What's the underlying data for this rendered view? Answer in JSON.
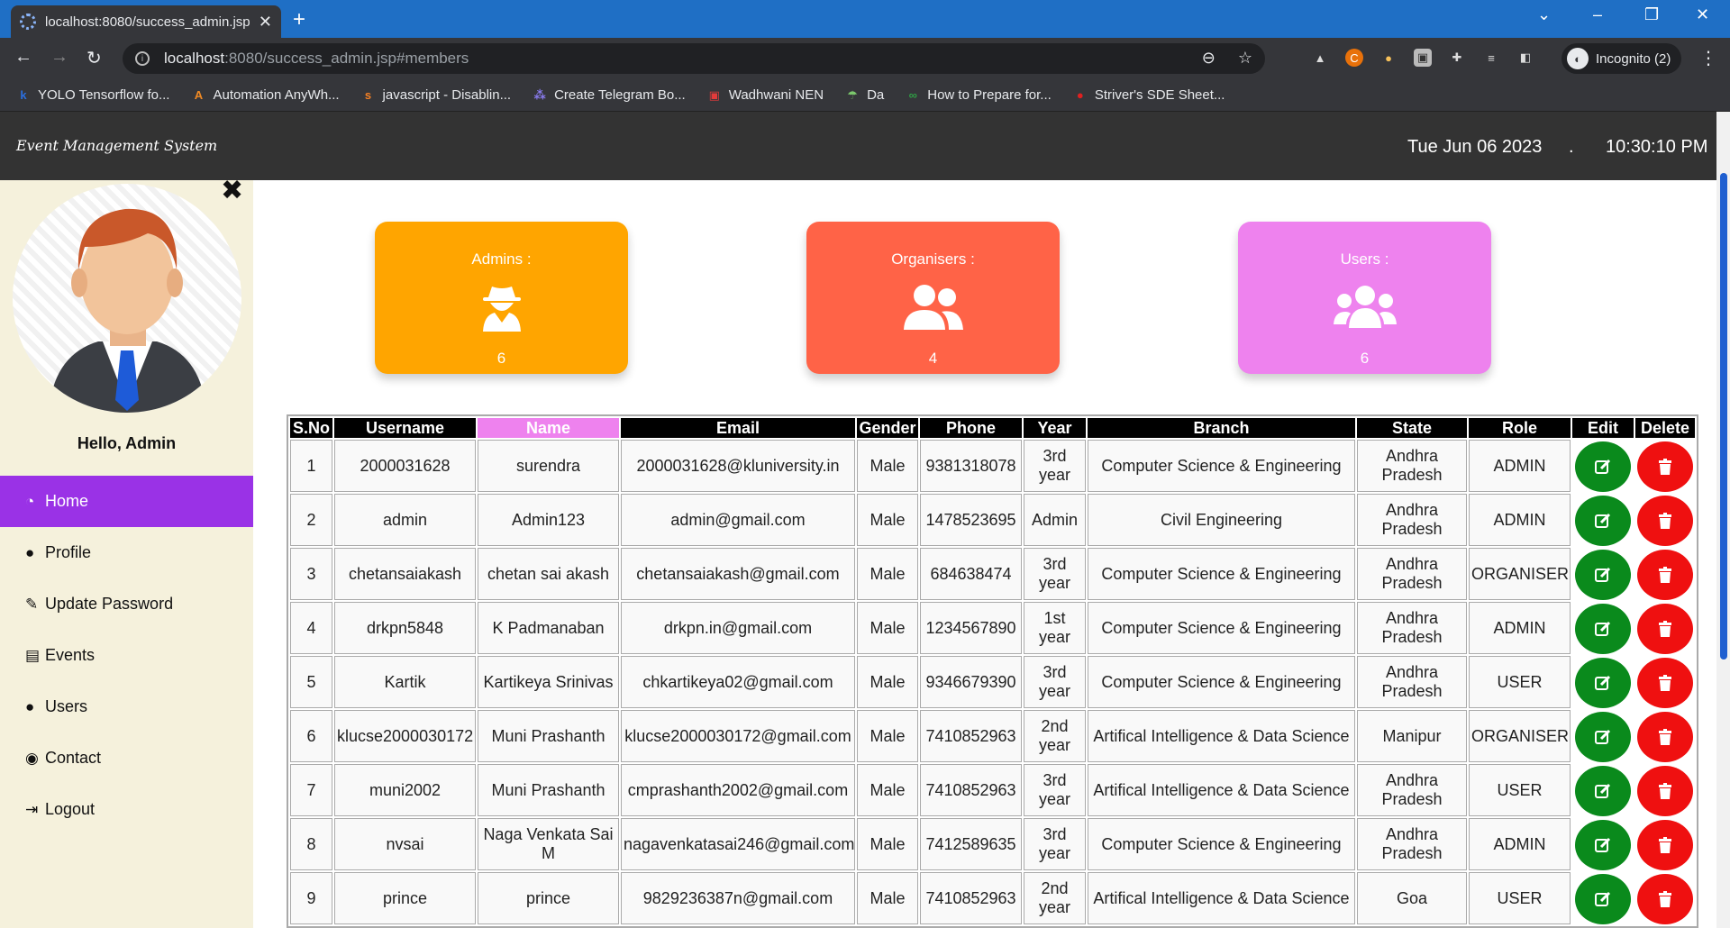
{
  "browser": {
    "tab_title": "localhost:8080/success_admin.jsp",
    "url_host": "localhost",
    "url_path": ":8080/success_admin.jsp#members",
    "incognito_label": "Incognito (2)",
    "bookmarks": [
      {
        "label": "YOLO Tensorflow fo...",
        "icon": "k",
        "color": "#2b6fe0"
      },
      {
        "label": "Automation AnyWh...",
        "icon": "A",
        "color": "#f08a24"
      },
      {
        "label": "javascript - Disablin...",
        "icon": "s",
        "color": "#f48024"
      },
      {
        "label": "Create Telegram Bo...",
        "icon": "⁂",
        "color": "#8a7cf0"
      },
      {
        "label": "Wadhwani NEN",
        "icon": "▣",
        "color": "#e23b3b"
      },
      {
        "label": "Da",
        "icon": "☂",
        "color": "#7bc86c"
      },
      {
        "label": "How to Prepare for...",
        "icon": "∞",
        "color": "#2f9e44"
      },
      {
        "label": "Striver's SDE Sheet...",
        "icon": "●",
        "color": "#e02020"
      }
    ]
  },
  "app": {
    "brand": "Event Management System",
    "date": "Tue Jun 06 2023",
    "separator": ".",
    "time": "10:30:10 PM"
  },
  "sidebar": {
    "greeting": "Hello, Admin",
    "items": [
      {
        "label": "Home",
        "icon": "dashboard-icon",
        "glyph": "◔",
        "active": true
      },
      {
        "label": "Profile",
        "icon": "user-icon",
        "glyph": "●",
        "active": false
      },
      {
        "label": "Update Password",
        "icon": "edit-icon",
        "glyph": "✎",
        "active": false
      },
      {
        "label": "Events",
        "icon": "book-icon",
        "glyph": "▤",
        "active": false
      },
      {
        "label": "Users",
        "icon": "user-icon",
        "glyph": "●",
        "active": false
      },
      {
        "label": "Contact",
        "icon": "comments-icon",
        "glyph": "◉",
        "active": false
      },
      {
        "label": "Logout",
        "icon": "logout-icon",
        "glyph": "⇥",
        "active": false
      }
    ]
  },
  "stats": [
    {
      "label": "Admins :",
      "value": "6",
      "color": "#ffa500",
      "icon": "user-secret-icon"
    },
    {
      "label": "Organisers :",
      "value": "4",
      "color": "#ff6347",
      "icon": "user-friends-icon"
    },
    {
      "label": "Users :",
      "value": "6",
      "color": "#ee82ee",
      "icon": "users-icon"
    }
  ],
  "table": {
    "headers": [
      "S.No",
      "Username",
      "Name",
      "Email",
      "Gender",
      "Phone",
      "Year",
      "Branch",
      "State",
      "Role",
      "Edit",
      "Delete"
    ],
    "rows": [
      [
        "1",
        "2000031628",
        "surendra",
        "2000031628@kluniversity.in",
        "Male",
        "9381318078",
        "3rd year",
        "Computer Science & Engineering",
        "Andhra Pradesh",
        "ADMIN"
      ],
      [
        "2",
        "admin",
        "Admin123",
        "admin@gmail.com",
        "Male",
        "1478523695",
        "Admin",
        "Civil Engineering",
        "Andhra Pradesh",
        "ADMIN"
      ],
      [
        "3",
        "chetansaiakash",
        "chetan sai akash",
        "chetansaiakash@gmail.com",
        "Male",
        "684638474",
        "3rd year",
        "Computer Science & Engineering",
        "Andhra Pradesh",
        "ORGANISER"
      ],
      [
        "4",
        "drkpn5848",
        "K Padmanaban",
        "drkpn.in@gmail.com",
        "Male",
        "1234567890",
        "1st year",
        "Computer Science & Engineering",
        "Andhra Pradesh",
        "ADMIN"
      ],
      [
        "5",
        "Kartik",
        "Kartikeya Srinivas",
        "chkartikeya02@gmail.com",
        "Male",
        "9346679390",
        "3rd year",
        "Computer Science & Engineering",
        "Andhra Pradesh",
        "USER"
      ],
      [
        "6",
        "klucse2000030172",
        "Muni Prashanth",
        "klucse2000030172@gmail.com",
        "Male",
        "7410852963",
        "2nd year",
        "Artifical Intelligence & Data Science",
        "Manipur",
        "ORGANISER"
      ],
      [
        "7",
        "muni2002",
        "Muni Prashanth",
        "cmprashanth2002@gmail.com",
        "Male",
        "7410852963",
        "3rd year",
        "Artifical Intelligence & Data Science",
        "Andhra Pradesh",
        "USER"
      ],
      [
        "8",
        "nvsai",
        "Naga Venkata Sai M",
        "nagavenkatasai246@gmail.com",
        "Male",
        "7412589635",
        "3rd year",
        "Computer Science & Engineering",
        "Andhra Pradesh",
        "ADMIN"
      ],
      [
        "9",
        "prince",
        "prince",
        "9829236387n@gmail.com",
        "Male",
        "7410852963",
        "2nd year",
        "Artifical Intelligence & Data Science",
        "Goa",
        "USER"
      ]
    ]
  }
}
